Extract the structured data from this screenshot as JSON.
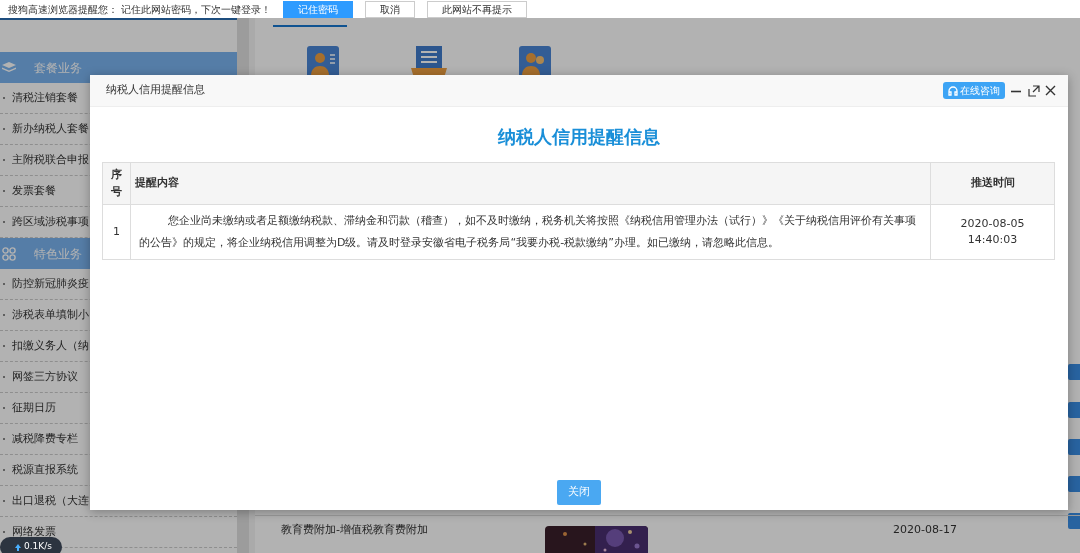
{
  "browser_prompt": {
    "message": "搜狗高速浏览器提醒您： 记住此网站密码，下次一键登录！",
    "buttons": [
      {
        "label": "记住密码",
        "primary": true
      },
      {
        "label": "取消",
        "primary": false
      },
      {
        "label": "此网站不再提示",
        "primary": false
      }
    ]
  },
  "sidebar": {
    "sections": [
      {
        "title": "套餐业务",
        "kind": "stack",
        "items": [
          "清税注销套餐",
          "新办纳税人套餐",
          "主附税联合申报",
          "发票套餐",
          "跨区域涉税事项"
        ]
      },
      {
        "title": "特色业务",
        "kind": "grid",
        "items": [
          "防控新冠肺炎疫",
          "涉税表单填制小",
          "扣缴义务人（纳",
          "网签三方协议",
          "征期日历",
          "减税降费专栏",
          "税源直报系统",
          "出口退税（大连",
          "网络发票"
        ]
      }
    ]
  },
  "content": {
    "rows": [
      {
        "item": "教育费附加-增值税教育费附加",
        "date": "2020-08-17"
      }
    ]
  },
  "network_speed": "0.1K/s",
  "dialog": {
    "title": "纳税人信用提醒信息",
    "consult_button": "在线咨询",
    "heading": "纳税人信用提醒信息",
    "table": {
      "columns": [
        "序号",
        "提醒内容",
        "推送时间"
      ],
      "rows": [
        {
          "number": "1",
          "content": "您企业尚未缴纳或者足额缴纳税款、滞纳金和罚款（稽查），如不及时缴纳，税务机关将按照《纳税信用管理办法（试行）》《关于纳税信用评价有关事项的公告》的规定，将企业纳税信用调整为D级。请及时登录安徽省电子税务局“我要办税-税款缴纳”办理。如已缴纳，请忽略此信息。",
          "time": "2020-08-05 14:40:03"
        }
      ]
    },
    "close_button": "关闭"
  }
}
